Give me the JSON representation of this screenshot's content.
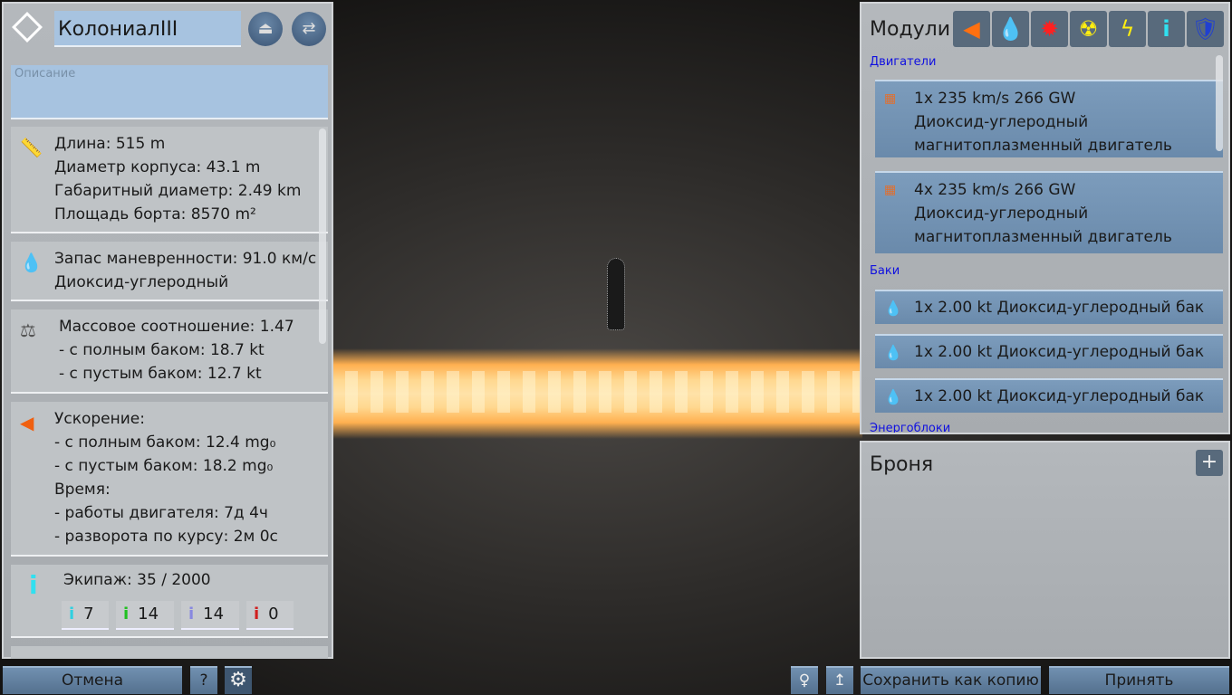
{
  "ship": {
    "name": "КолониалIII",
    "description_placeholder": "Описание"
  },
  "stats": {
    "dimensions": [
      "Длина: 515 m",
      "Диаметр корпуса: 43.1 m",
      "Габаритный диаметр: 2.49 km",
      "Площадь борта: 8570 m²"
    ],
    "delta_v": [
      "Запас маневренности: 91.0 км/с",
      "Диоксид-углеродный"
    ],
    "mass": [
      "Массовое соотношение: 1.47",
      " - с полным баком: 18.7 kt",
      " - с пустым баком: 12.7 kt"
    ],
    "accel": [
      "Ускорение:",
      " - с полным баком: 12.4 mg₀",
      " - с пустым баком: 18.2 mg₀",
      "Время:",
      " - работы двигателя: 7д 4ч",
      " - разворота по курсу: 2м 0с"
    ],
    "crew": {
      "label": "Экипаж: 35 / 2000",
      "counts": [
        "7",
        "14",
        "14",
        "0"
      ],
      "colors": [
        "#30d0e0",
        "#20c020",
        "#8888e0",
        "#d02020"
      ]
    }
  },
  "modules": {
    "title": "Модули",
    "icons": [
      "thruster-icon",
      "propellant-icon",
      "laser-icon",
      "reactor-icon",
      "power-icon",
      "crew-icon",
      "radiator-shield-icon"
    ],
    "categories": {
      "engines": "Двигатели",
      "tanks": "Баки",
      "power": "Энергоблоки"
    },
    "engines": [
      [
        "1x 235 km/s 266 GW",
        "Диоксид-углеродный",
        "магнитоплазменный двигатель"
      ],
      [
        "4x 235 km/s 266 GW",
        "Диоксид-углеродный",
        "магнитоплазменный двигатель"
      ]
    ],
    "tanks": [
      "1x 2.00 kt Диоксид-углеродный бак",
      "1x 2.00 kt Диоксид-углеродный бак",
      "1x 2.00 kt Диоксид-углеродный бак"
    ]
  },
  "armor": {
    "title": "Броня",
    "add": "+"
  },
  "footer": {
    "cancel": "Отмена",
    "help": "?",
    "save_copy": "Сохранить как копию",
    "accept": "Принять"
  }
}
